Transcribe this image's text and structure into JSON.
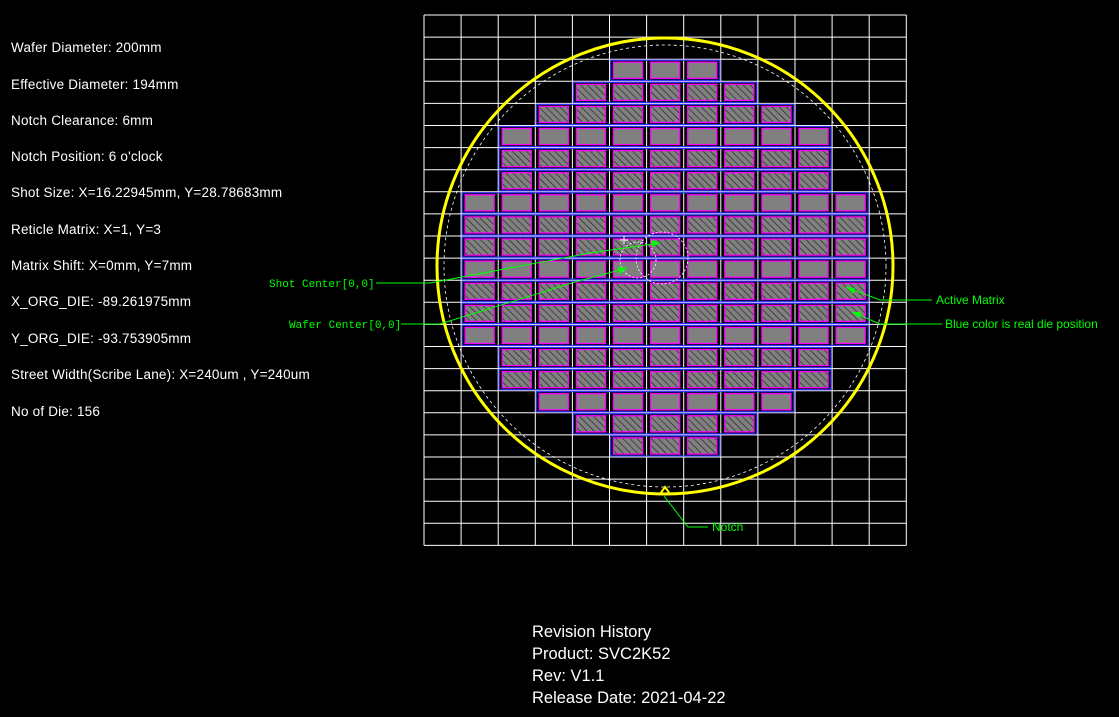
{
  "specs": [
    "Wafer Diameter: 200mm",
    "Effective Diameter: 194mm",
    "Notch Clearance: 6mm",
    "Notch Position: 6 o'clock",
    "Shot Size: X=16.22945mm, Y=28.78683mm",
    "Reticle Matrix: X=1, Y=3",
    "Matrix Shift: X=0mm, Y=7mm",
    "X_ORG_DIE: -89.261975mm",
    "Y_ORG_DIE: -93.753905mm",
    "Street Width(Scribe Lane): X=240um , Y=240um",
    "No of Die: 156"
  ],
  "annotations": {
    "shot_center": "Shot Center[0,0]",
    "wafer_center": "Wafer Center[0,0]",
    "active_matrix": "Active Matrix",
    "blue_color": "Blue  color is real  die position",
    "notch": "Notch"
  },
  "revision": {
    "heading": "Revision History",
    "product": "Product: SVC2K52",
    "rev": "Rev: V1.1",
    "release_date": "Release Date: 2021-04-22"
  },
  "wafer_rows": [
    {
      "row": 2,
      "cols": [
        5,
        6,
        7
      ]
    },
    {
      "row": 3,
      "cols": [
        4,
        5,
        6,
        7,
        8
      ]
    },
    {
      "row": 4,
      "cols": [
        3,
        4,
        5,
        6,
        7,
        8,
        9
      ]
    },
    {
      "row": 5,
      "cols": [
        2,
        3,
        4,
        5,
        6,
        7,
        8,
        9,
        10
      ]
    },
    {
      "row": 6,
      "cols": [
        2,
        3,
        4,
        5,
        6,
        7,
        8,
        9,
        10
      ]
    },
    {
      "row": 7,
      "cols": [
        2,
        3,
        4,
        5,
        6,
        7,
        8,
        9,
        10
      ]
    },
    {
      "row": 8,
      "cols": [
        1,
        2,
        3,
        4,
        5,
        6,
        7,
        8,
        9,
        10,
        11
      ]
    },
    {
      "row": 9,
      "cols": [
        1,
        2,
        3,
        4,
        5,
        6,
        7,
        8,
        9,
        10,
        11
      ]
    },
    {
      "row": 10,
      "cols": [
        1,
        2,
        3,
        4,
        5,
        6,
        7,
        8,
        9,
        10,
        11
      ]
    },
    {
      "row": 11,
      "cols": [
        1,
        2,
        3,
        4,
        5,
        6,
        7,
        8,
        9,
        10,
        11
      ]
    },
    {
      "row": 12,
      "cols": [
        1,
        2,
        3,
        4,
        5,
        6,
        7,
        8,
        9,
        10,
        11
      ]
    },
    {
      "row": 13,
      "cols": [
        1,
        2,
        3,
        4,
        5,
        6,
        7,
        8,
        9,
        10,
        11
      ]
    },
    {
      "row": 14,
      "cols": [
        1,
        2,
        3,
        4,
        5,
        6,
        7,
        8,
        9,
        10,
        11
      ]
    },
    {
      "row": 15,
      "cols": [
        2,
        3,
        4,
        5,
        6,
        7,
        8,
        9,
        10
      ]
    },
    {
      "row": 16,
      "cols": [
        2,
        3,
        4,
        5,
        6,
        7,
        8,
        9,
        10
      ]
    },
    {
      "row": 17,
      "cols": [
        3,
        4,
        5,
        6,
        7,
        8,
        9
      ]
    },
    {
      "row": 18,
      "cols": [
        4,
        5,
        6,
        7,
        8
      ]
    },
    {
      "row": 19,
      "cols": [
        5,
        6,
        7
      ]
    }
  ],
  "colors": {
    "background": "#000000",
    "grid": "#ffffff",
    "wafer_edge": "#ffff00",
    "die_fill": "#808080",
    "die_border": "#ff00ff",
    "die_position": "#3030ff",
    "annotation": "#00ff00"
  }
}
